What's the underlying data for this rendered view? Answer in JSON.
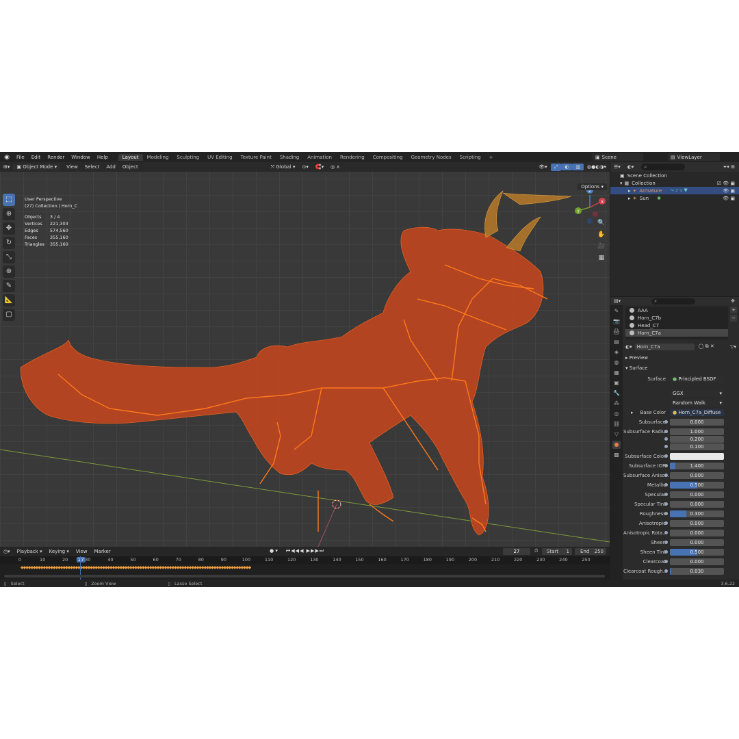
{
  "menu": [
    "File",
    "Edit",
    "Render",
    "Window",
    "Help"
  ],
  "workspaces": [
    {
      "label": "Layout",
      "active": true
    },
    {
      "label": "Modeling",
      "active": false
    },
    {
      "label": "Sculpting",
      "active": false
    },
    {
      "label": "UV Editing",
      "active": false
    },
    {
      "label": "Texture Paint",
      "active": false
    },
    {
      "label": "Shading",
      "active": false
    },
    {
      "label": "Animation",
      "active": false
    },
    {
      "label": "Rendering",
      "active": false
    },
    {
      "label": "Compositing",
      "active": false
    },
    {
      "label": "Geometry Nodes",
      "active": false
    },
    {
      "label": "Scripting",
      "active": false
    }
  ],
  "scene": "Scene",
  "view_layer": "ViewLayer",
  "viewport_header": {
    "mode": "Object Mode",
    "menus": [
      "View",
      "Select",
      "Add",
      "Object"
    ],
    "orientation": "Global",
    "options": "Options"
  },
  "overlay": {
    "view_name": "User Perspective",
    "collection": "(27) Collection | Horn_C",
    "stats": [
      {
        "label": "Objects",
        "value": "3 / 4"
      },
      {
        "label": "Vertices",
        "value": "221,303"
      },
      {
        "label": "Edges",
        "value": "574,560"
      },
      {
        "label": "Faces",
        "value": "355,160"
      },
      {
        "label": "Triangles",
        "value": "355,160"
      }
    ]
  },
  "gizmo": {
    "x": "X",
    "y": "Y",
    "z": "Z"
  },
  "timeline": {
    "menus": [
      "Playback",
      "Keying",
      "View",
      "Marker"
    ],
    "current_frame": "27",
    "start_label": "Start",
    "start": "1",
    "end_label": "End",
    "end": "250",
    "ticks": [
      "0",
      "10",
      "20",
      "30",
      "40",
      "50",
      "60",
      "70",
      "80",
      "90",
      "100",
      "110",
      "120",
      "130",
      "140",
      "150",
      "160",
      "170",
      "180",
      "190",
      "200",
      "210",
      "220",
      "230",
      "240",
      "250"
    ]
  },
  "status": {
    "select": "Select",
    "zoom": "Zoom View",
    "lasso": "Lasso Select",
    "version": "3.6.22"
  },
  "outliner": {
    "root": "Scene Collection",
    "collection": "Collection",
    "items": [
      {
        "label": "Armature",
        "selected": true
      },
      {
        "label": "Sun",
        "selected": false
      }
    ]
  },
  "material": {
    "slots": [
      {
        "label": "AAA",
        "selected": false
      },
      {
        "label": "Horn_C7b",
        "selected": false
      },
      {
        "label": "Head_C7",
        "selected": false
      },
      {
        "label": "Horn_C7a",
        "selected": true
      }
    ],
    "name": "Horn_C7a",
    "preview_label": "Preview",
    "surface_section": "Surface",
    "surface_label": "Surface",
    "surface_shader": "Principled BSDF",
    "distribution": "GGX",
    "subsurface_method": "Random Walk",
    "base_color_label": "Base Color",
    "base_color_texture": "Horn_C7a_Diffuse",
    "fields": [
      {
        "label": "Subsurface",
        "value": "0.000",
        "fill": 0
      },
      {
        "label": "Subsurface Radius",
        "value": "1.000",
        "fill": 0
      },
      {
        "label": "",
        "value": "0.200",
        "fill": 0
      },
      {
        "label": "",
        "value": "0.100",
        "fill": 0
      },
      {
        "label": "Subsurface Color",
        "value": "",
        "fill": 0,
        "color": "#e8e8e8"
      },
      {
        "label": "Subsurface IOR",
        "value": "1.400",
        "fill": 0.1
      },
      {
        "label": "Subsurface Aniso...",
        "value": "0.000",
        "fill": 0
      },
      {
        "label": "Metallic",
        "value": "0.500",
        "fill": 0.5
      },
      {
        "label": "Specular",
        "value": "0.000",
        "fill": 0
      },
      {
        "label": "Specular Tint",
        "value": "0.000",
        "fill": 0
      },
      {
        "label": "Roughness",
        "value": "0.300",
        "fill": 0.3
      },
      {
        "label": "Anisotropic",
        "value": "0.000",
        "fill": 0
      },
      {
        "label": "Anisotropic Rota...",
        "value": "0.000",
        "fill": 0
      },
      {
        "label": "Sheen",
        "value": "0.000",
        "fill": 0
      },
      {
        "label": "Sheen Tint",
        "value": "0.500",
        "fill": 0.5
      },
      {
        "label": "Clearcoat",
        "value": "0.000",
        "fill": 0
      },
      {
        "label": "Clearcoat Rough...",
        "value": "0.030",
        "fill": 0.03
      }
    ]
  },
  "colors": {
    "accent": "#4772b3",
    "selection_orange": "#ff7a1a",
    "viewport_bg": "#393939"
  }
}
